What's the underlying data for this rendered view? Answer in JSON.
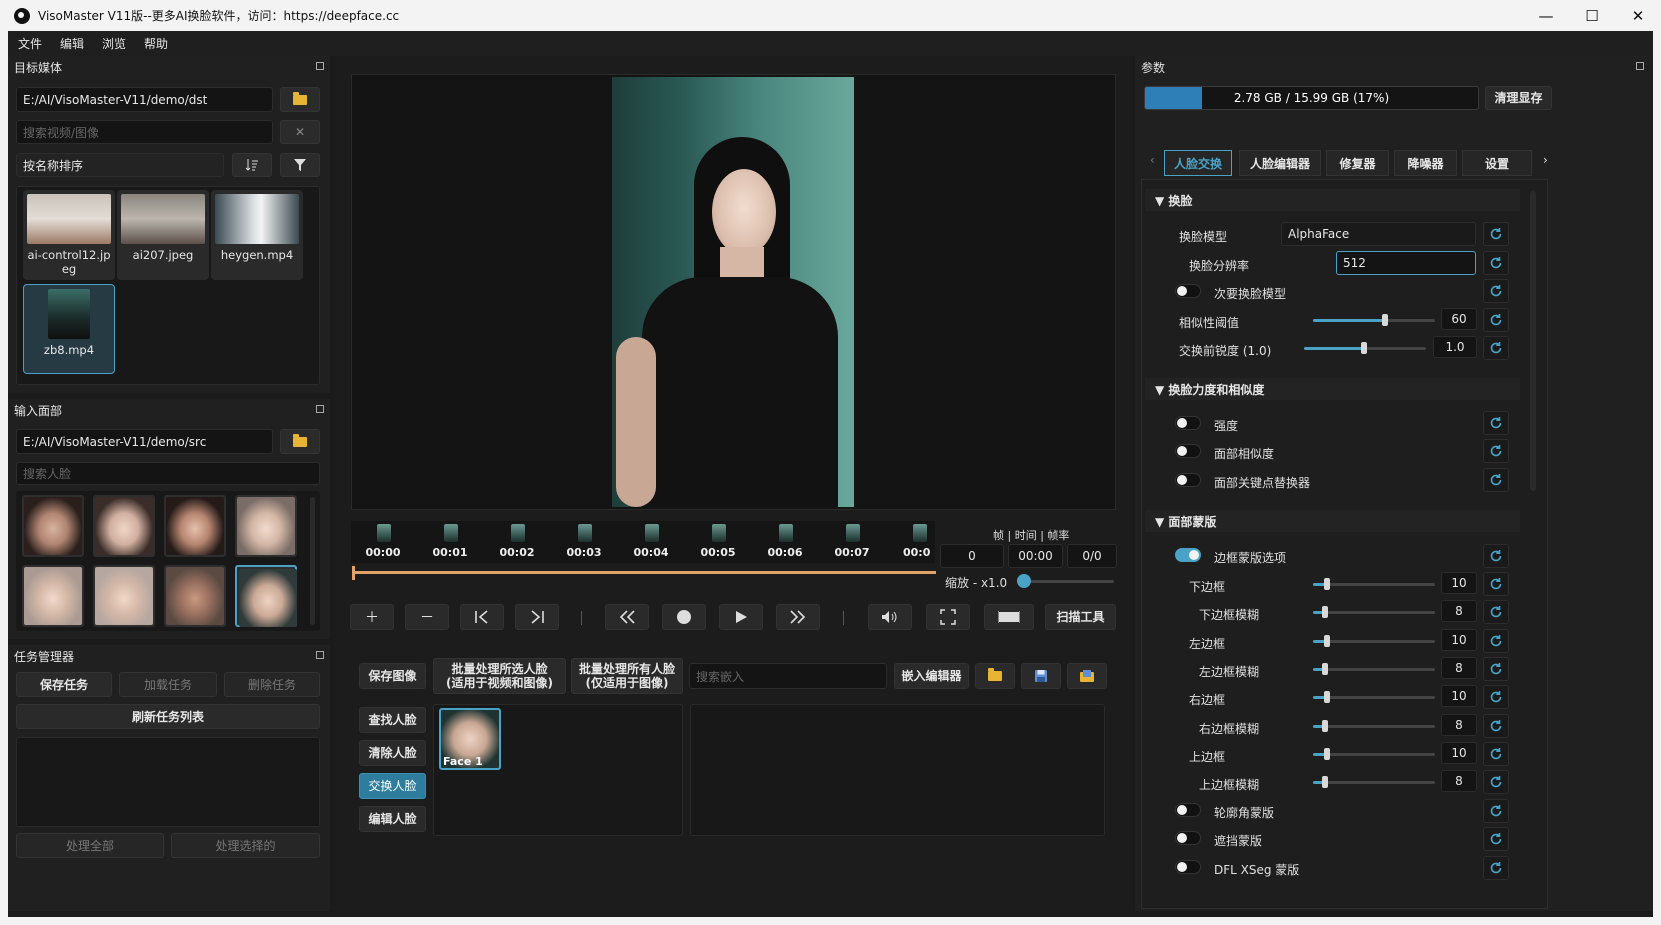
{
  "window": {
    "title": "VisoMaster V11版--更多AI换脸软件，访问：https://deepface.cc",
    "minimize": "—",
    "maximize": "☐",
    "close": "✕"
  },
  "menu": [
    "文件",
    "编辑",
    "浏览",
    "帮助"
  ],
  "target_media": {
    "title": "目标媒体",
    "path": "E:/AI/VisoMaster-V11/demo/dst",
    "search_placeholder": "搜索视频/图像",
    "clear": "✕",
    "sort_label": "按名称排序",
    "items": [
      {
        "name": "ai-control12.jpeg",
        "selected": false
      },
      {
        "name": "ai207.jpeg",
        "selected": false
      },
      {
        "name": "heygen.mp4",
        "selected": false
      },
      {
        "name": "zb8.mp4",
        "selected": true
      }
    ]
  },
  "input_faces": {
    "title": "输入面部",
    "path": "E:/AI/VisoMaster-V11/demo/src",
    "search_placeholder": "搜索人脸",
    "faces": [
      {
        "selected": false
      },
      {
        "selected": false
      },
      {
        "selected": false
      },
      {
        "selected": false
      },
      {
        "selected": false
      },
      {
        "selected": false
      },
      {
        "selected": false
      },
      {
        "selected": true
      }
    ]
  },
  "task_manager": {
    "title": "任务管理器",
    "save": "保存任务",
    "load": "加载任务",
    "delete": "删除任务",
    "refresh": "刷新任务列表",
    "process_all": "处理全部",
    "process_selected": "处理选择的"
  },
  "timeline": {
    "frames": [
      "00:00",
      "00:01",
      "00:02",
      "00:03",
      "00:04",
      "00:05",
      "00:06",
      "00:07",
      "00:0"
    ],
    "info_label": "帧 | 时间 | 帧率",
    "frame": "0",
    "time": "00:00",
    "fps": "0/0",
    "zoom_label": "缩放 - x1.0",
    "scan_tool": "扫描工具"
  },
  "face_actions": {
    "save_image": "保存图像",
    "batch_selected_l1": "批量处理所选人脸",
    "batch_selected_l2": "(适用于视频和图像)",
    "batch_all_l1": "批量处理所有人脸",
    "batch_all_l2": "(仅适用于图像)",
    "search_embed_placeholder": "搜索嵌入",
    "embed_editor": "嵌入编辑器",
    "find_face": "查找人脸",
    "clear_face": "清除人脸",
    "swap_face": "交换人脸",
    "edit_face": "编辑人脸",
    "detected_face_label": "Face 1"
  },
  "params": {
    "title": "参数",
    "vram_text": "2.78 GB / 15.99 GB (17%)",
    "vram_fraction": 0.17,
    "clear_vram": "清理显存",
    "tabs": [
      {
        "label": "人脸交换",
        "active": true
      },
      {
        "label": "人脸编辑器",
        "active": false
      },
      {
        "label": "修复器",
        "active": false
      },
      {
        "label": "降噪器",
        "active": false
      },
      {
        "label": "设置",
        "active": false
      }
    ],
    "sections": {
      "swap": "▼  换脸",
      "strength": "▼  换脸力度和相似度",
      "mask": "▼  面部蒙版"
    },
    "swap_model_label": "换脸模型",
    "swap_model_value": "AlphaFace",
    "swap_resolution_label": "换脸分辨率",
    "swap_resolution_value": "512",
    "secondary_model_label": "次要换脸模型",
    "similarity_label": "相似性阈值",
    "similarity_value": "60",
    "sharpness_label": "交换前锐度 (1.0)",
    "sharpness_value": "1.0",
    "strength_label": "强度",
    "face_similarity_label": "面部相似度",
    "landmark_label": "面部关键点替换器",
    "border_mask_label": "边框蒙版选项",
    "bottom_label": "下边框",
    "bottom_value": "10",
    "bottom_blur_label": "下边框模糊",
    "bottom_blur_value": "8",
    "left_label": "左边框",
    "left_value": "10",
    "left_blur_label": "左边框模糊",
    "left_blur_value": "8",
    "right_label": "右边框",
    "right_value": "10",
    "right_blur_label": "右边框模糊",
    "right_blur_value": "8",
    "top_label": "上边框",
    "top_value": "10",
    "top_blur_label": "上边框模糊",
    "top_blur_value": "8",
    "contour_label": "轮廓角蒙版",
    "occlusion_label": "遮挡蒙版",
    "xseg_label": "DFL XSeg 蒙版"
  },
  "colors": {
    "accent": "#4aa3c7",
    "folder": "#e7b533"
  }
}
